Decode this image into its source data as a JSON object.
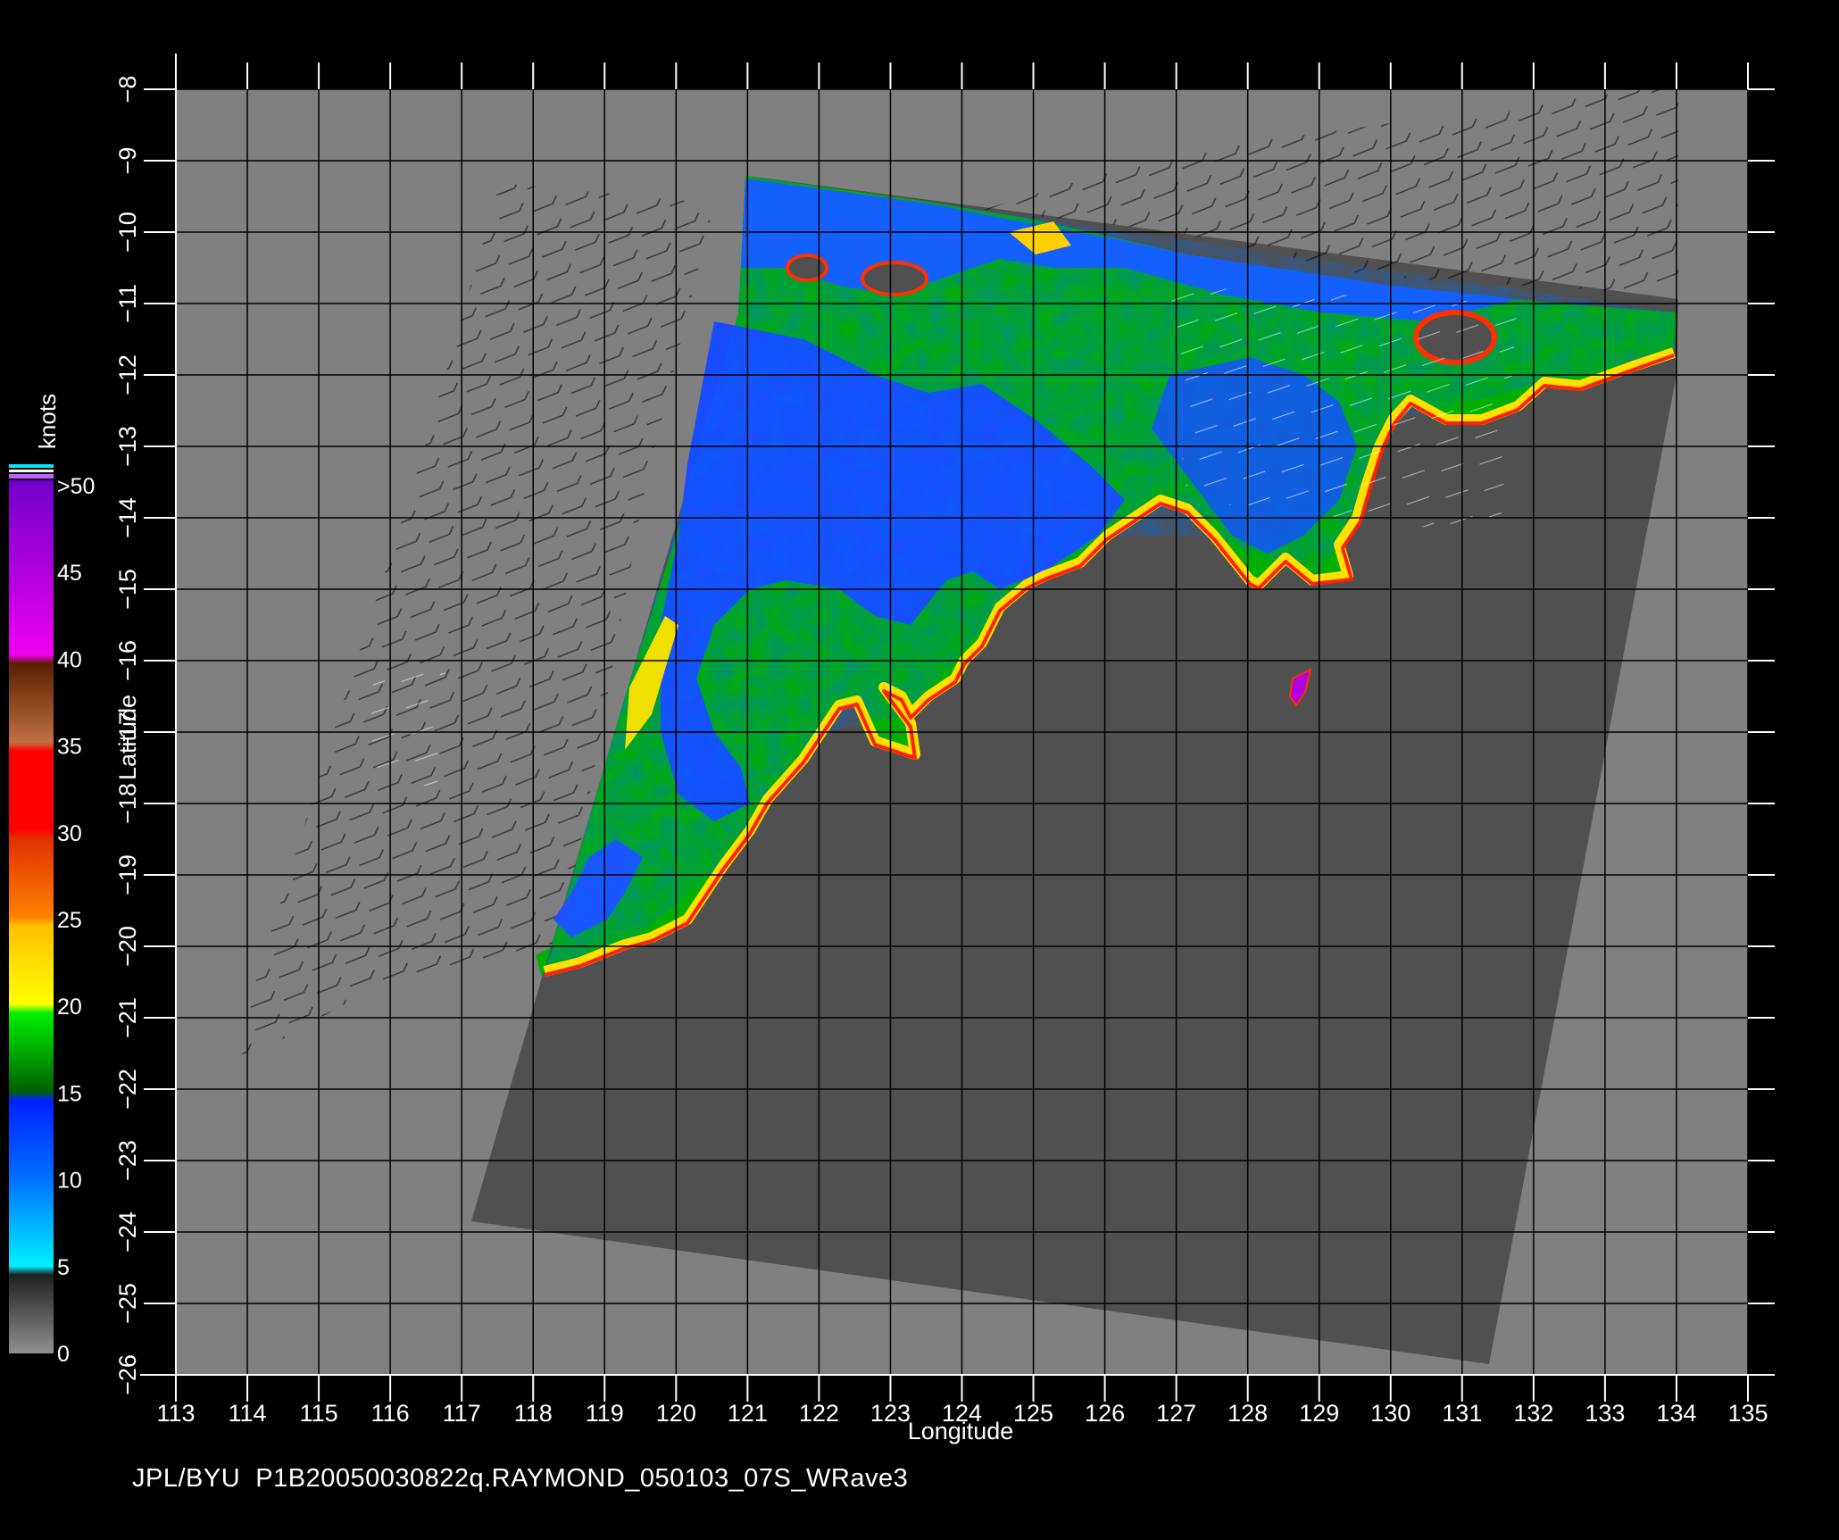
{
  "map": {
    "x_axis_label": "Longitude",
    "y_axis_label": "Latitude",
    "x_ticks": [
      "113",
      "114",
      "115",
      "116",
      "117",
      "118",
      "119",
      "120",
      "121",
      "122",
      "123",
      "124",
      "125",
      "126",
      "127",
      "128",
      "129",
      "130",
      "131",
      "132",
      "133",
      "134",
      "135"
    ],
    "y_ticks": [
      "−8",
      "−9",
      "−10",
      "−11",
      "−12",
      "−13",
      "−14",
      "−15",
      "−16",
      "−17",
      "−18",
      "−19",
      "−20",
      "−21",
      "−22",
      "−23",
      "−24",
      "−25",
      "−26"
    ],
    "lon_range": [
      113,
      135
    ],
    "lat_range": [
      -26,
      -8
    ],
    "grid": true
  },
  "legend": {
    "title": "knots",
    "labels": [
      ">50",
      "45",
      "40",
      "35",
      "30",
      "25",
      "20",
      "15",
      "10",
      "5",
      "0"
    ],
    "colors": {
      "purple": "#7000c8",
      "magenta": "#f000f0",
      "brown": "#5a2000",
      "red": "#ff0000",
      "orange": "#ff7000",
      "yellow": "#ffe000",
      "green": "#00e000",
      "dark_green": "#007000",
      "blue": "#0040ff",
      "light_blue": "#0090ff",
      "cyan": "#00e8ff",
      "dark_gray": "#303030",
      "gray": "#808080"
    }
  },
  "colors": {
    "background": "#000000",
    "plot_background": "#808080",
    "swath": "#505050",
    "grid": "#000000",
    "land_low": "#0040ff",
    "land_mid": "#00c000",
    "land_high": "#ffe000"
  },
  "footer": {
    "text": "JPL/BYU  P1B20050030822q.RAYMOND_050103_07S_WRave3"
  }
}
